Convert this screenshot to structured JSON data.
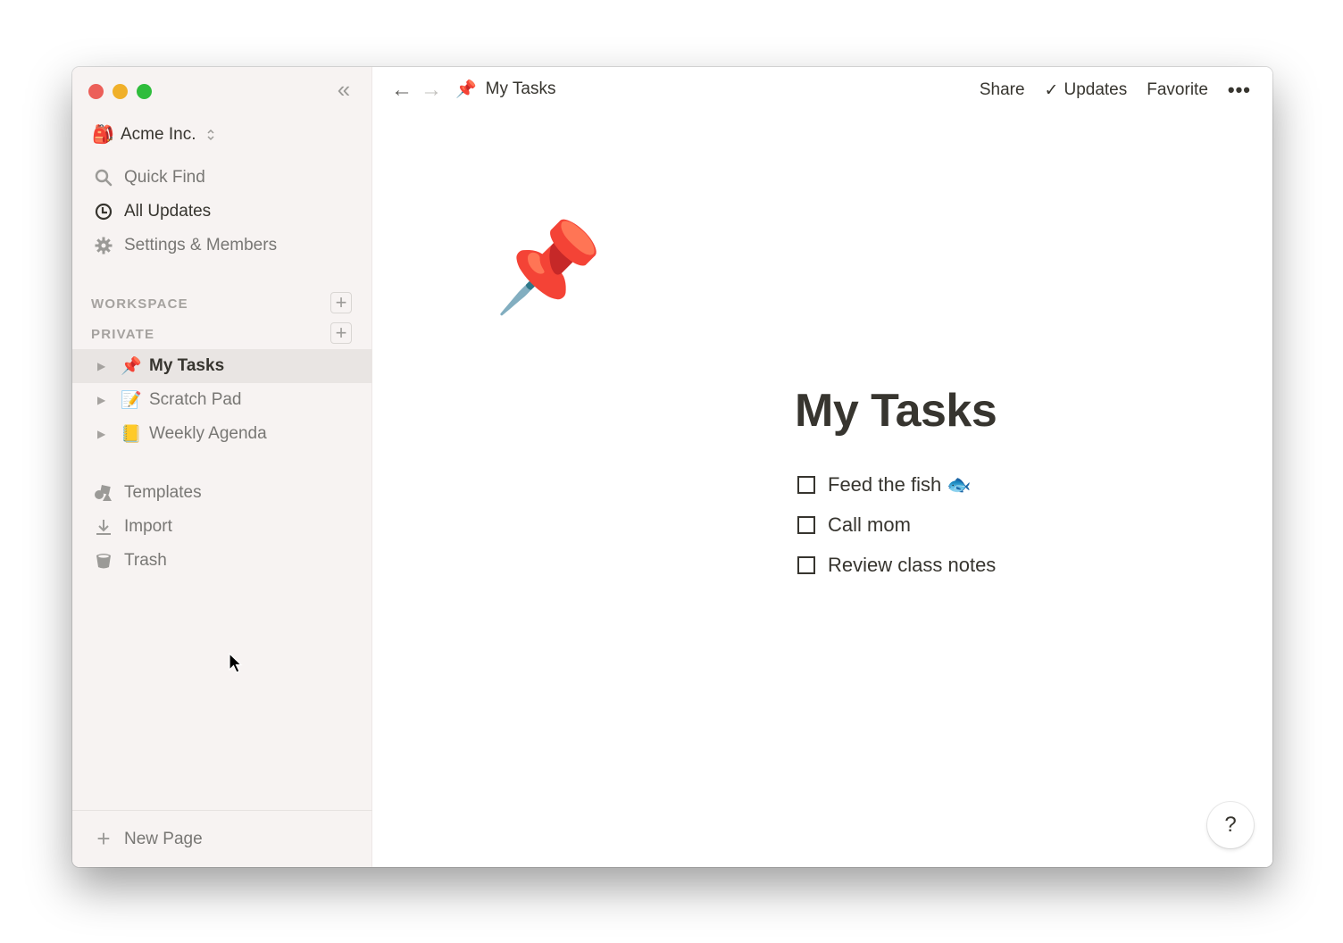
{
  "window": {
    "traffic_lights": [
      "close",
      "minimize",
      "zoom"
    ]
  },
  "sidebar": {
    "collapse_icon": "double-chevron-left-icon",
    "collapse_glyph": "«",
    "workspace": {
      "icon": "🎒",
      "name": "Acme Inc.",
      "switcher_icon": "up-down-chevron-icon"
    },
    "nav": [
      {
        "icon": "search-icon",
        "label": "Quick Find"
      },
      {
        "icon": "clock-icon",
        "label": "All Updates"
      },
      {
        "icon": "gear-icon",
        "label": "Settings & Members"
      }
    ],
    "sections": [
      {
        "label": "WORKSPACE",
        "add_glyph": "+"
      },
      {
        "label": "PRIVATE",
        "add_glyph": "+"
      }
    ],
    "pages": [
      {
        "emoji": "📌",
        "label": "My Tasks",
        "active": true
      },
      {
        "emoji": "📝",
        "label": "Scratch Pad",
        "active": false
      },
      {
        "emoji": "📒",
        "label": "Weekly Agenda",
        "active": false
      }
    ],
    "tools": [
      {
        "icon": "templates-icon",
        "label": "Templates"
      },
      {
        "icon": "import-icon",
        "label": "Import"
      },
      {
        "icon": "trash-icon",
        "label": "Trash"
      }
    ],
    "footer": {
      "plus_glyph": "+",
      "label": "New Page"
    }
  },
  "topbar": {
    "back_glyph": "←",
    "forward_glyph": "→",
    "breadcrumb": {
      "emoji": "📌",
      "label": "My Tasks"
    },
    "actions": {
      "share": "Share",
      "updates_check": "✓",
      "updates": "Updates",
      "favorite": "Favorite",
      "more": "•••"
    }
  },
  "page": {
    "icon": "📌",
    "title": "My Tasks",
    "todos": [
      {
        "text": "Feed the fish 🐟",
        "checked": false
      },
      {
        "text": "Call mom",
        "checked": false
      },
      {
        "text": "Review class notes",
        "checked": false
      }
    ]
  },
  "help": {
    "label": "?"
  }
}
